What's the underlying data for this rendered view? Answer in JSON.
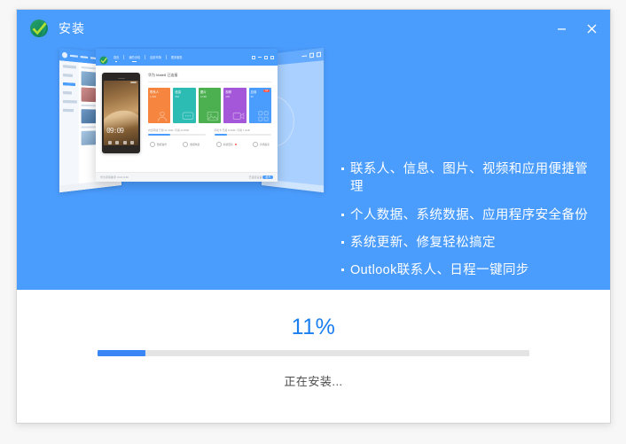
{
  "window": {
    "title": "安装",
    "logo_icon": "app-logo-icon",
    "minimize_icon": "minimize-icon",
    "close_icon": "close-icon"
  },
  "theme": {
    "brand_blue": "#4a9cfd",
    "progress_blue": "#3a86f7",
    "percent_blue": "#1a7ff0",
    "track_gray": "#e4e4e4"
  },
  "hero": {
    "artwork_name": "phone-manager-preview-artwork",
    "front_window": {
      "nav": [
        {
          "label": "首页",
          "active": true
        },
        {
          "label": "我的手机",
          "active": true
        },
        {
          "label": "应用市场",
          "active": false
        },
        {
          "label": "更多服务",
          "active": false
        }
      ],
      "device_name": "华为 Mate8 已连接",
      "tiles": [
        {
          "title": "联系人",
          "sub": "1,026",
          "color": "#f5853f",
          "glyph": "contact-icon",
          "badge": ""
        },
        {
          "title": "信息",
          "sub": "362",
          "color": "#2dbcb4",
          "glyph": "message-icon",
          "badge": ""
        },
        {
          "title": "图片",
          "sub": "2,189",
          "color": "#4cb050",
          "glyph": "picture-icon",
          "badge": ""
        },
        {
          "title": "视频",
          "sub": "108",
          "color": "#a457d8",
          "glyph": "video-icon",
          "badge": ""
        },
        {
          "title": "应用",
          "sub": "96",
          "color": "#4a9cfd",
          "glyph": "apps-icon",
          "badge": "12"
        }
      ],
      "storage": [
        {
          "label": "内部存储  已用 41.2GB / 可用 22.8GB",
          "percent": 38
        },
        {
          "label": "手机卡  已用 8.6GB / 可用 7.4GB",
          "percent": 23
        }
      ],
      "actions": [
        {
          "label": "数据备份",
          "glyph": "backup-icon",
          "dot": false
        },
        {
          "label": "数据恢复",
          "glyph": "restore-icon",
          "dot": false
        },
        {
          "label": "系统更新",
          "glyph": "update-icon",
          "dot": true
        },
        {
          "label": "手机搬家",
          "glyph": "migrate-icon",
          "dot": false
        }
      ],
      "footer_left": "华为手机助手 V3.0.0.30",
      "footer_right": "已连接设备",
      "footer_pill": "断开"
    }
  },
  "features": [
    "联系人、信息、图片、视频和应用便捷管理",
    "个人数据、系统数据、应用程序安全备份",
    "系统更新、修复轻松搞定",
    "Outlook联系人、日程一键同步"
  ],
  "progress": {
    "percent_label": "11%",
    "percent_value": 11,
    "status": "正在安装..."
  }
}
